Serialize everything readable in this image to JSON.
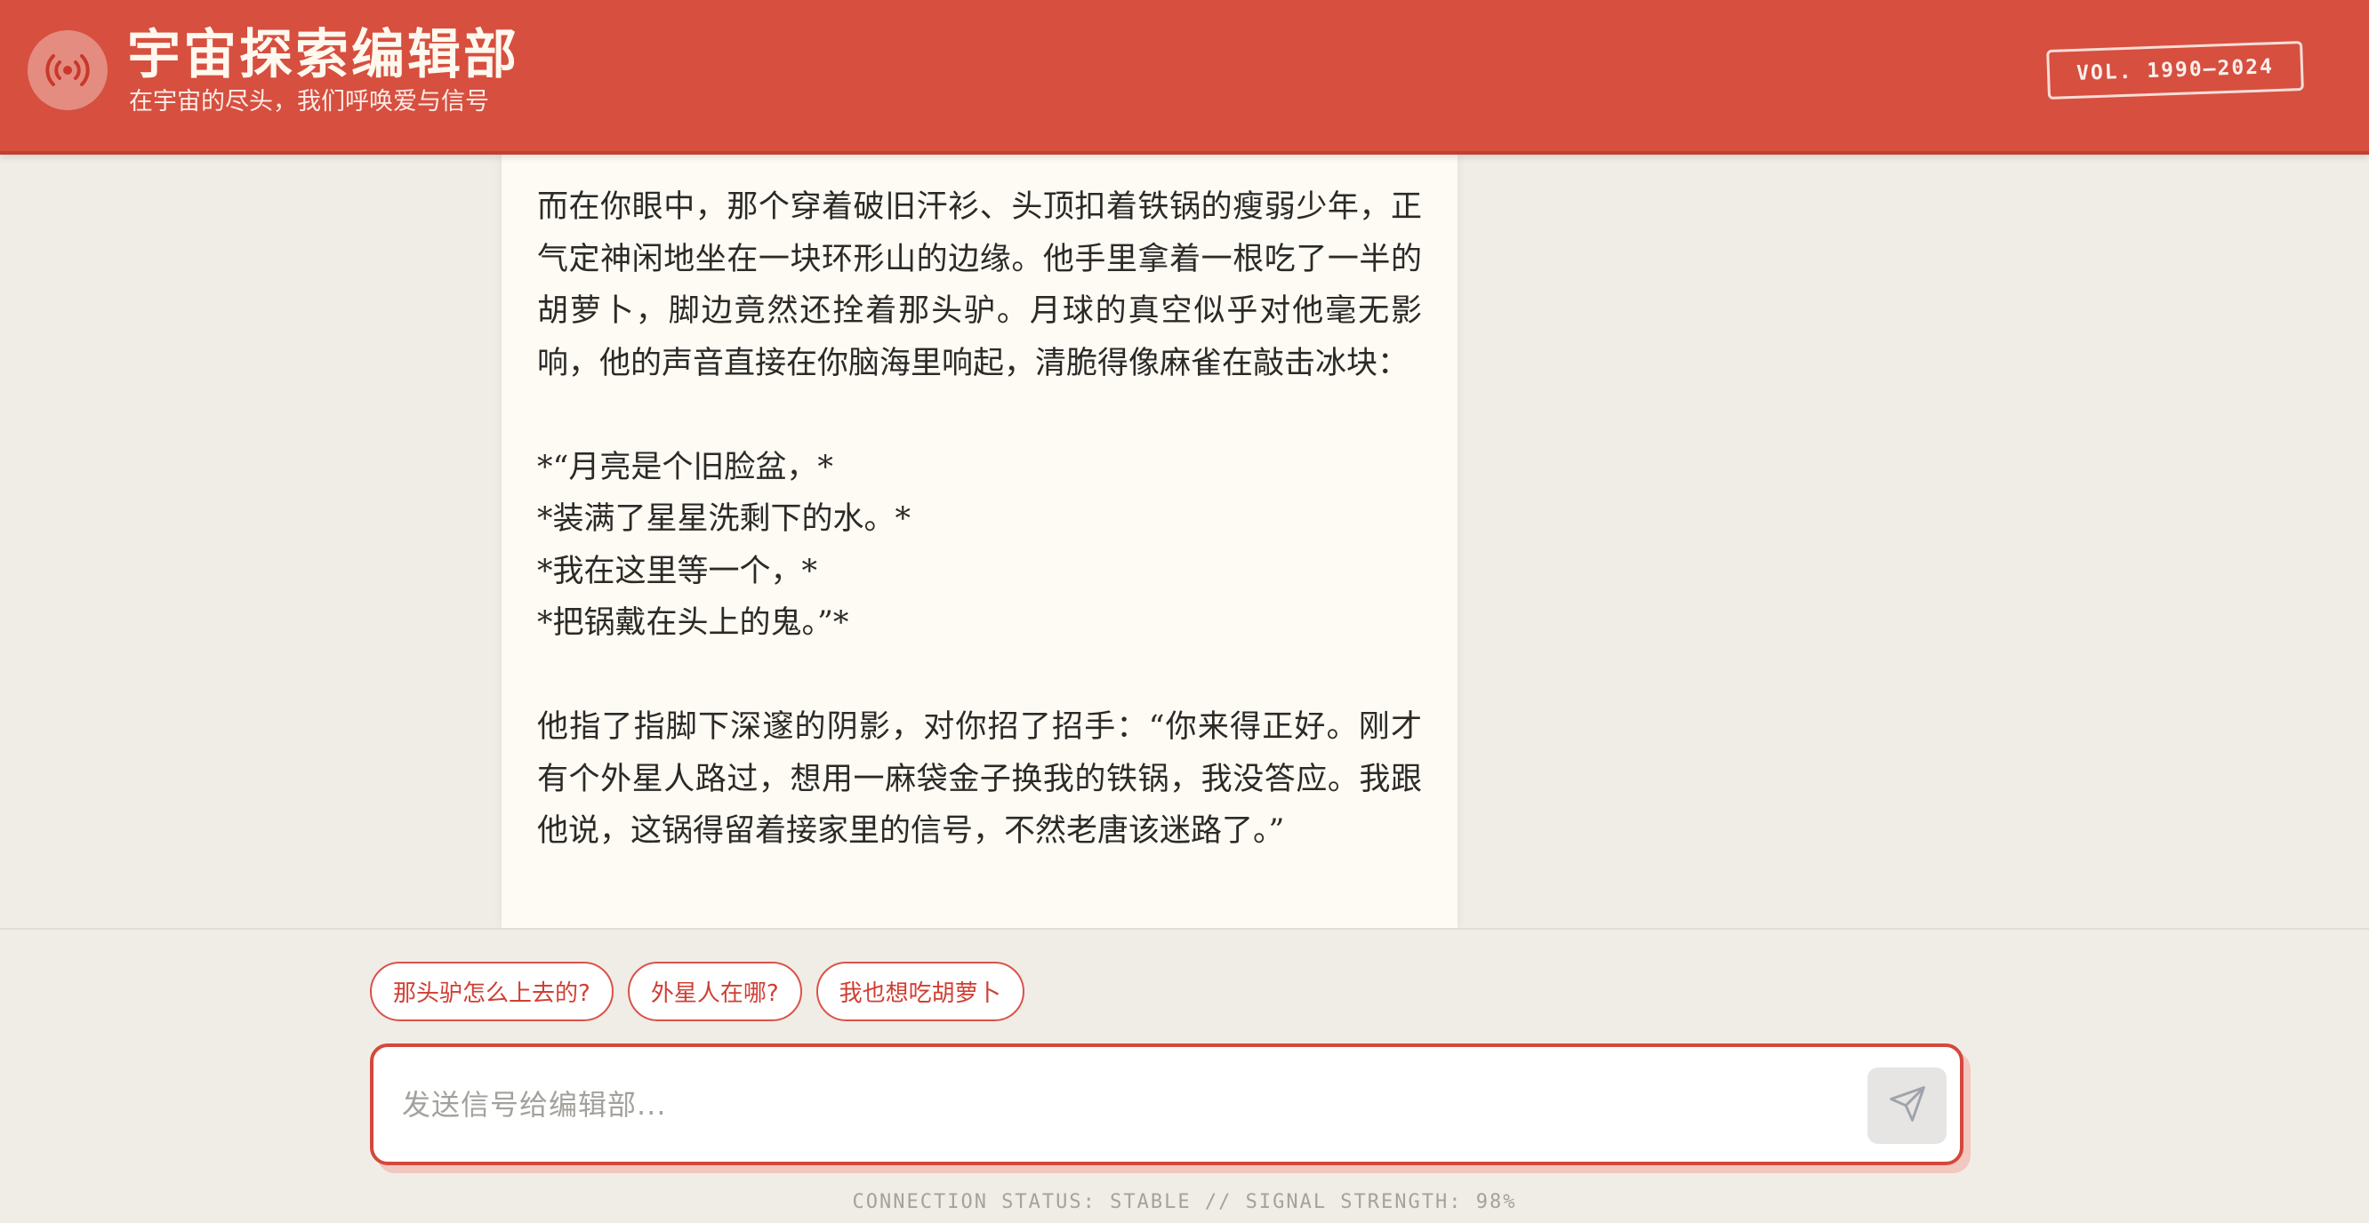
{
  "header": {
    "logo_icon": "broadcast-signal-icon",
    "title": "宇宙探索编辑部",
    "subtitle": "在宇宙的尽头，我们呼唤爱与信号",
    "vol_badge": "VOL. 1990–2024"
  },
  "article": {
    "paragraph_1": "而在你眼中，那个穿着破旧汗衫、头顶扣着铁锅的瘦弱少年，正气定神闲地坐在一块环形山的边缘。他手里拿着一根吃了一半的胡萝卜，脚边竟然还拴着那头驴。月球的真空似乎对他毫无影响，他的声音直接在你脑海里响起，清脆得像麻雀在敲击冰块：",
    "verse": [
      "*“月亮是个旧脸盆，*",
      "*装满了星星洗剩下的水。*",
      "*我在这里等一个，*",
      "*把锅戴在头上的鬼。”*"
    ],
    "paragraph_2": "他指了指脚下深邃的阴影，对你招了招手：“你来得正好。刚才有个外星人路过，想用一麻袋金子换我的铁锅，我没答应。我跟他说，这锅得留着接家里的信号，不然老唐该迷路了。”"
  },
  "suggestions": [
    "那头驴怎么上去的?",
    "外星人在哪?",
    "我也想吃胡萝卜"
  ],
  "input": {
    "placeholder": "发送信号给编辑部...",
    "value": "",
    "send_icon": "paper-plane-icon"
  },
  "status_text": "CONNECTION STATUS: STABLE // SIGNAL STRENGTH: 98%",
  "colors": {
    "header_bg": "#d64f3f",
    "accent": "#d4483b",
    "page_bg": "#f0ede6",
    "article_bg": "#fdfbf4"
  }
}
